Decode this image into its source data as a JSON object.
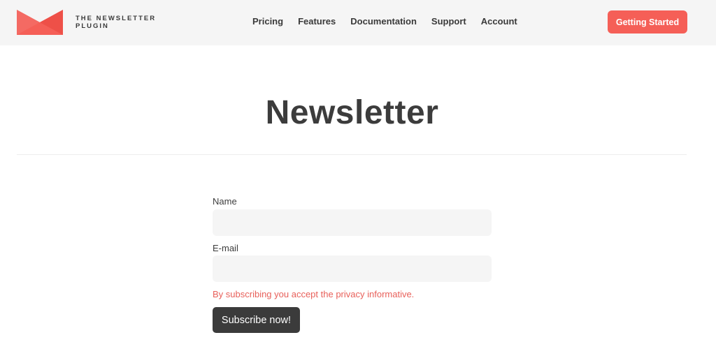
{
  "brand": {
    "name_line1": "THE NEWSLETTER",
    "name_line2": "PLUGIN",
    "accent": "#f55f57",
    "logo_icon": "envelope-logo-icon"
  },
  "nav": {
    "items": [
      {
        "label": "Pricing"
      },
      {
        "label": "Features"
      },
      {
        "label": "Documentation"
      },
      {
        "label": "Support"
      },
      {
        "label": "Account"
      }
    ]
  },
  "header": {
    "cta_label": "Getting Started"
  },
  "main": {
    "title": "Newsletter"
  },
  "form": {
    "name_label": "Name",
    "name_value": "",
    "email_label": "E-mail",
    "email_value": "",
    "privacy_text": "By subscribing you accept the privacy informative.",
    "submit_label": "Subscribe now!"
  }
}
